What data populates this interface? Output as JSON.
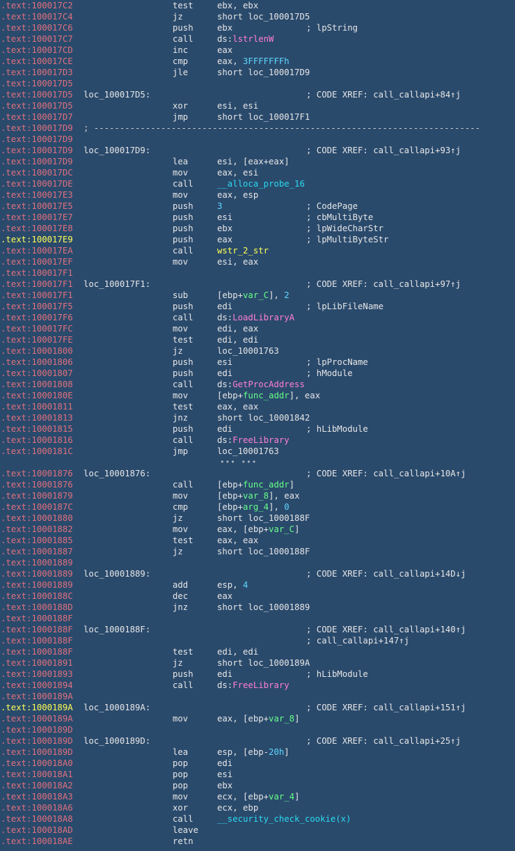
{
  "colors": {
    "background": "#2a4a6c",
    "address": "#e0707d",
    "highlight_address": "#ffff55",
    "api_name": "#ff7fd0",
    "local_func": "#2ad9f0",
    "variable": "#66ff88",
    "number": "#5fd7ff"
  },
  "lines": [
    {
      "addr": ".text:100017C2",
      "mn": "test",
      "op": [
        {
          "t": "ebx, ebx"
        }
      ]
    },
    {
      "addr": ".text:100017C4",
      "mn": "jz",
      "op": [
        {
          "t": "short loc_100017D5"
        }
      ]
    },
    {
      "addr": ".text:100017C6",
      "mn": "push",
      "op": [
        {
          "t": "ebx"
        }
      ],
      "cm": "; lpString"
    },
    {
      "addr": ".text:100017C7",
      "mn": "call",
      "op": [
        {
          "t": "ds:"
        },
        {
          "t": "lstrlenW",
          "c": "api"
        }
      ]
    },
    {
      "addr": ".text:100017CD",
      "mn": "inc",
      "op": [
        {
          "t": "eax"
        }
      ]
    },
    {
      "addr": ".text:100017CE",
      "mn": "cmp",
      "op": [
        {
          "t": "eax, "
        },
        {
          "t": "3FFFFFFFh",
          "c": "num"
        }
      ]
    },
    {
      "addr": ".text:100017D3",
      "mn": "jle",
      "op": [
        {
          "t": "short loc_100017D9"
        }
      ]
    },
    {
      "addr": ".text:100017D5"
    },
    {
      "addr": ".text:100017D5",
      "label": "loc_100017D5:",
      "cm": "; CODE XREF: call_callapi+84↑j"
    },
    {
      "addr": ".text:100017D5",
      "mn": "xor",
      "op": [
        {
          "t": "esi, esi"
        }
      ]
    },
    {
      "addr": ".text:100017D7",
      "mn": "jmp",
      "op": [
        {
          "t": "short loc_100017F1"
        }
      ]
    },
    {
      "addr": ".text:100017D9",
      "sep": "; ---------------------------------------------------------------------------"
    },
    {
      "addr": ".text:100017D9"
    },
    {
      "addr": ".text:100017D9",
      "label": "loc_100017D9:",
      "cm": "; CODE XREF: call_callapi+93↑j"
    },
    {
      "addr": ".text:100017D9",
      "mn": "lea",
      "op": [
        {
          "t": "esi, [eax+eax]"
        }
      ]
    },
    {
      "addr": ".text:100017DC",
      "mn": "mov",
      "op": [
        {
          "t": "eax, esi"
        }
      ]
    },
    {
      "addr": ".text:100017DE",
      "mn": "call",
      "op": [
        {
          "t": "__alloca_probe_16",
          "c": "fnc"
        }
      ]
    },
    {
      "addr": ".text:100017E3",
      "mn": "mov",
      "op": [
        {
          "t": "eax, esp"
        }
      ]
    },
    {
      "addr": ".text:100017E5",
      "mn": "push",
      "op": [
        {
          "t": "3",
          "c": "num"
        }
      ],
      "cm": "; CodePage"
    },
    {
      "addr": ".text:100017E7",
      "mn": "push",
      "op": [
        {
          "t": "esi"
        }
      ],
      "cm": "; cbMultiByte"
    },
    {
      "addr": ".text:100017E8",
      "mn": "push",
      "op": [
        {
          "t": "ebx"
        }
      ],
      "cm": "; lpWideCharStr"
    },
    {
      "addr": ".text:100017E9",
      "hl": true,
      "mn": "push",
      "op": [
        {
          "t": "eax"
        }
      ],
      "cm": "; lpMultiByteStr"
    },
    {
      "addr": ".text:100017EA",
      "mn": "call",
      "op": [
        {
          "t": "wstr_2_str",
          "c": "fny"
        }
      ]
    },
    {
      "addr": ".text:100017EF",
      "mn": "mov",
      "op": [
        {
          "t": "esi, eax"
        }
      ]
    },
    {
      "addr": ".text:100017F1"
    },
    {
      "addr": ".text:100017F1",
      "label": "loc_100017F1:",
      "cm": "; CODE XREF: call_callapi+97↑j"
    },
    {
      "addr": ".text:100017F1",
      "mn": "sub",
      "op": [
        {
          "t": "[ebp+"
        },
        {
          "t": "var_C",
          "c": "var"
        },
        {
          "t": "], "
        },
        {
          "t": "2",
          "c": "num"
        }
      ]
    },
    {
      "addr": ".text:100017F5",
      "mn": "push",
      "op": [
        {
          "t": "edi"
        }
      ],
      "cm": "; lpLibFileName"
    },
    {
      "addr": ".text:100017F6",
      "mn": "call",
      "op": [
        {
          "t": "ds:"
        },
        {
          "t": "LoadLibraryA",
          "c": "api"
        }
      ]
    },
    {
      "addr": ".text:100017FC",
      "mn": "mov",
      "op": [
        {
          "t": "edi, eax"
        }
      ]
    },
    {
      "addr": ".text:100017FE",
      "mn": "test",
      "op": [
        {
          "t": "edi, edi"
        }
      ]
    },
    {
      "addr": ".text:10001800",
      "mn": "jz",
      "op": [
        {
          "t": "loc_10001763"
        }
      ]
    },
    {
      "addr": ".text:10001806",
      "mn": "push",
      "op": [
        {
          "t": "esi"
        }
      ],
      "cm": "; lpProcName"
    },
    {
      "addr": ".text:10001807",
      "mn": "push",
      "op": [
        {
          "t": "edi"
        }
      ],
      "cm": "; hModule"
    },
    {
      "addr": ".text:10001808",
      "mn": "call",
      "op": [
        {
          "t": "ds:"
        },
        {
          "t": "GetProcAddress",
          "c": "api"
        }
      ]
    },
    {
      "addr": ".text:1000180E",
      "mn": "mov",
      "op": [
        {
          "t": "[ebp+"
        },
        {
          "t": "func_addr",
          "c": "var"
        },
        {
          "t": "], eax"
        }
      ]
    },
    {
      "addr": ".text:10001811",
      "mn": "test",
      "op": [
        {
          "t": "eax, eax"
        }
      ]
    },
    {
      "addr": ".text:10001813",
      "mn": "jnz",
      "op": [
        {
          "t": "short loc_10001842"
        }
      ]
    },
    {
      "addr": ".text:10001815",
      "mn": "push",
      "op": [
        {
          "t": "edi"
        }
      ],
      "cm": "; hLibModule"
    },
    {
      "addr": ".text:10001816",
      "mn": "call",
      "op": [
        {
          "t": "ds:"
        },
        {
          "t": "FreeLibrary",
          "c": "api"
        }
      ]
    },
    {
      "addr": ".text:1000181C",
      "mn": "jmp",
      "op": [
        {
          "t": "loc_10001763"
        }
      ]
    },
    {
      "gap": "••• •••"
    },
    {
      "addr": ".text:10001876",
      "label": "loc_10001876:",
      "cm": "; CODE XREF: call_callapi+10A↑j"
    },
    {
      "addr": ".text:10001876",
      "mn": "call",
      "op": [
        {
          "t": "[ebp+"
        },
        {
          "t": "func_addr",
          "c": "var"
        },
        {
          "t": "]"
        }
      ]
    },
    {
      "addr": ".text:10001879",
      "mn": "mov",
      "op": [
        {
          "t": "[ebp+"
        },
        {
          "t": "var_8",
          "c": "var"
        },
        {
          "t": "], eax"
        }
      ]
    },
    {
      "addr": ".text:1000187C",
      "mn": "cmp",
      "op": [
        {
          "t": "[ebp+"
        },
        {
          "t": "arg_4",
          "c": "var"
        },
        {
          "t": "], "
        },
        {
          "t": "0",
          "c": "num"
        }
      ]
    },
    {
      "addr": ".text:10001880",
      "mn": "jz",
      "op": [
        {
          "t": "short loc_1000188F"
        }
      ]
    },
    {
      "addr": ".text:10001882",
      "mn": "mov",
      "op": [
        {
          "t": "eax, [ebp+"
        },
        {
          "t": "var_C",
          "c": "var"
        },
        {
          "t": "]"
        }
      ]
    },
    {
      "addr": ".text:10001885",
      "mn": "test",
      "op": [
        {
          "t": "eax, eax"
        }
      ]
    },
    {
      "addr": ".text:10001887",
      "mn": "jz",
      "op": [
        {
          "t": "short loc_1000188F"
        }
      ]
    },
    {
      "addr": ".text:10001889"
    },
    {
      "addr": ".text:10001889",
      "label": "loc_10001889:",
      "cm": "; CODE XREF: call_callapi+14D↓j"
    },
    {
      "addr": ".text:10001889",
      "mn": "add",
      "op": [
        {
          "t": "esp, "
        },
        {
          "t": "4",
          "c": "num"
        }
      ]
    },
    {
      "addr": ".text:1000188C",
      "mn": "dec",
      "op": [
        {
          "t": "eax"
        }
      ]
    },
    {
      "addr": ".text:1000188D",
      "mn": "jnz",
      "op": [
        {
          "t": "short loc_10001889"
        }
      ]
    },
    {
      "addr": ".text:1000188F"
    },
    {
      "addr": ".text:1000188F",
      "label": "loc_1000188F:",
      "cm": "; CODE XREF: call_callapi+140↑j"
    },
    {
      "addr": ".text:1000188F",
      "cm": "; call_callapi+147↑j"
    },
    {
      "addr": ".text:1000188F",
      "mn": "test",
      "op": [
        {
          "t": "edi, edi"
        }
      ]
    },
    {
      "addr": ".text:10001891",
      "mn": "jz",
      "op": [
        {
          "t": "short loc_1000189A"
        }
      ]
    },
    {
      "addr": ".text:10001893",
      "mn": "push",
      "op": [
        {
          "t": "edi"
        }
      ],
      "cm": "; hLibModule"
    },
    {
      "addr": ".text:10001894",
      "mn": "call",
      "op": [
        {
          "t": "ds:"
        },
        {
          "t": "FreeLibrary",
          "c": "api"
        }
      ]
    },
    {
      "addr": ".text:1000189A"
    },
    {
      "addr": ".text:1000189A",
      "hl": true,
      "label": "loc_1000189A:",
      "cm": "; CODE XREF: call_callapi+151↑j"
    },
    {
      "addr": ".text:1000189A",
      "mn": "mov",
      "op": [
        {
          "t": "eax, [ebp+"
        },
        {
          "t": "var_8",
          "c": "var"
        },
        {
          "t": "]"
        }
      ]
    },
    {
      "addr": ".text:1000189D"
    },
    {
      "addr": ".text:1000189D",
      "label": "loc_1000189D:",
      "cm": "; CODE XREF: call_callapi+25↑j"
    },
    {
      "addr": ".text:1000189D",
      "mn": "lea",
      "op": [
        {
          "t": "esp, [ebp-"
        },
        {
          "t": "20h",
          "c": "num"
        },
        {
          "t": "]"
        }
      ]
    },
    {
      "addr": ".text:100018A0",
      "mn": "pop",
      "op": [
        {
          "t": "edi"
        }
      ]
    },
    {
      "addr": ".text:100018A1",
      "mn": "pop",
      "op": [
        {
          "t": "esi"
        }
      ]
    },
    {
      "addr": ".text:100018A2",
      "mn": "pop",
      "op": [
        {
          "t": "ebx"
        }
      ]
    },
    {
      "addr": ".text:100018A3",
      "mn": "mov",
      "op": [
        {
          "t": "ecx, [ebp+"
        },
        {
          "t": "var_4",
          "c": "var"
        },
        {
          "t": "]"
        }
      ]
    },
    {
      "addr": ".text:100018A6",
      "mn": "xor",
      "op": [
        {
          "t": "ecx, ebp"
        }
      ]
    },
    {
      "addr": ".text:100018A8",
      "mn": "call",
      "op": [
        {
          "t": "__security_check_cookie(x)",
          "c": "fnc"
        }
      ]
    },
    {
      "addr": ".text:100018AD",
      "mn": "leave"
    },
    {
      "addr": ".text:100018AE",
      "mn": "retn"
    }
  ]
}
